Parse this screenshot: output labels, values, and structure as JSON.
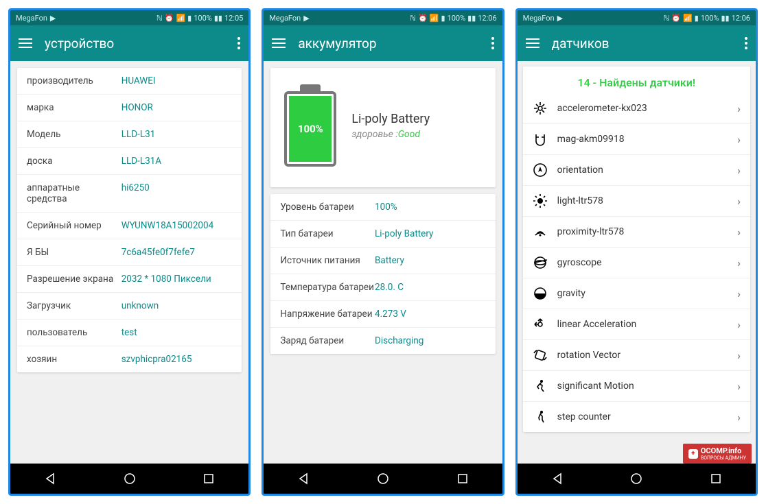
{
  "status": {
    "carrier": "MegaFon",
    "nfc": "ℕ",
    "battery_pct": "100%"
  },
  "times": [
    "12:05",
    "12:06",
    "12:06"
  ],
  "screens": [
    {
      "title": "устройство"
    },
    {
      "title": "аккумулятор"
    },
    {
      "title": "датчиков"
    }
  ],
  "device_rows": [
    {
      "k": "производитель",
      "v": "HUAWEI"
    },
    {
      "k": "марка",
      "v": "HONOR"
    },
    {
      "k": "Модель",
      "v": "LLD-L31"
    },
    {
      "k": "доска",
      "v": "LLD-L31A"
    },
    {
      "k": "аппаратные средства",
      "v": "hi6250"
    },
    {
      "k": "Серийный номер",
      "v": "WYUNW18A15002004"
    },
    {
      "k": "Я БЫ",
      "v": "7c6a45fe0f7fefe7"
    },
    {
      "k": "Разрешение экрана",
      "v": "2032 * 1080 Пиксели"
    },
    {
      "k": "Загрузчик",
      "v": "unknown"
    },
    {
      "k": "пользователь",
      "v": "test"
    },
    {
      "k": "хозяин",
      "v": "szvphicpra02165"
    }
  ],
  "battery": {
    "pct": "100%",
    "type": "Li-poly Battery",
    "health_label": "здоровье :",
    "health_value": "Good",
    "rows": [
      {
        "k": "Уровень батареи",
        "v": "100%"
      },
      {
        "k": "Тип батареи",
        "v": "Li-poly Battery"
      },
      {
        "k": "Источник питания",
        "v": "Battery"
      },
      {
        "k": "Температура батареи",
        "v": "28.0. C"
      },
      {
        "k": "Напряжение батареи",
        "v": "4.273 V"
      },
      {
        "k": "Заряд батареи",
        "v": "Discharging"
      }
    ]
  },
  "sensors": {
    "header": "14 - Найдены датчики!",
    "items": [
      {
        "icon": "accelerometer-icon",
        "label": "accelerometer-kx023"
      },
      {
        "icon": "magnet-icon",
        "label": "mag-akm09918"
      },
      {
        "icon": "compass-icon",
        "label": "orientation"
      },
      {
        "icon": "light-icon",
        "label": "light-ltr578"
      },
      {
        "icon": "proximity-icon",
        "label": "proximity-ltr578"
      },
      {
        "icon": "gyroscope-icon",
        "label": "gyroscope"
      },
      {
        "icon": "gravity-icon",
        "label": "gravity"
      },
      {
        "icon": "linear-accel-icon",
        "label": "linear Acceleration"
      },
      {
        "icon": "rotation-icon",
        "label": "rotation Vector"
      },
      {
        "icon": "motion-icon",
        "label": "significant Motion"
      },
      {
        "icon": "step-icon",
        "label": "step counter"
      }
    ]
  },
  "watermark": {
    "title": "OCOMP.info",
    "sub": "ВОПРОСЫ АДМИНУ"
  }
}
